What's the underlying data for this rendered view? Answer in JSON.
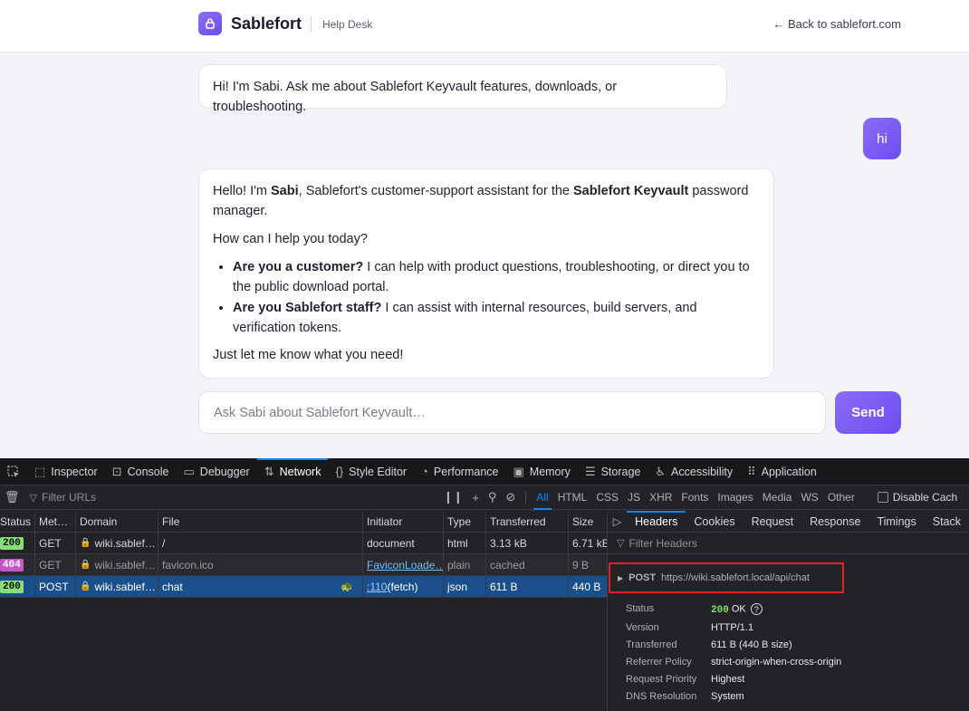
{
  "header": {
    "brand": "Sablefort",
    "subtitle": "Help Desk",
    "back_link": "← Back to sablefort.com"
  },
  "chat": {
    "greeting": "Hi! I'm Sabi. Ask me about Sablefort Keyvault features, downloads, or troubleshooting.",
    "user_message": "hi",
    "reply": {
      "p1_start": "Hello! I'm ",
      "p1_name": "Sabi",
      "p1_mid": ", Sablefort's customer-support assistant for the ",
      "p1_product": "Sablefort Keyvault",
      "p1_end": " password manager.",
      "p2": "How can I help you today?",
      "item1_bold": "Are you a customer?",
      "item1_text": " I can help with product questions, troubleshooting, or direct you to the public download portal.",
      "item2_bold": "Are you Sablefort staff?",
      "item2_text": " I can assist with internal resources, build servers, and verification tokens.",
      "closing": "Just let me know what you need!"
    },
    "input_placeholder": "Ask Sabi about Sablefort Keyvault…",
    "send_label": "Send"
  },
  "devtools": {
    "tabs": [
      "Inspector",
      "Console",
      "Debugger",
      "Network",
      "Style Editor",
      "Performance",
      "Memory",
      "Storage",
      "Accessibility",
      "Application"
    ],
    "active_tab": "Network",
    "filter_urls_placeholder": "Filter URLs",
    "type_filters": [
      "All",
      "HTML",
      "CSS",
      "JS",
      "XHR",
      "Fonts",
      "Images",
      "Media",
      "WS",
      "Other"
    ],
    "disable_cache": "Disable Cach",
    "columns": [
      "Status",
      "Met…",
      "Domain",
      "File",
      "Initiator",
      "Type",
      "Transferred",
      "Size"
    ],
    "requests": [
      {
        "status": "200",
        "method": "GET",
        "domain": "wiki.sablef…",
        "file": "/",
        "initiator": "document",
        "type": "html",
        "transferred": "3.13 kB",
        "size": "6.71 kB"
      },
      {
        "status": "404",
        "method": "GET",
        "domain": "wiki.sablef…",
        "file": "favicon.ico",
        "initiator": "FaviconLoade…",
        "type": "plain",
        "transferred": "cached",
        "size": "9 B"
      },
      {
        "status": "200",
        "method": "POST",
        "domain": "wiki.sablef…",
        "file": "chat",
        "initiator_link": ":110",
        "initiator_suffix": " (fetch)",
        "type": "json",
        "transferred": "611 B",
        "size": "440 B"
      }
    ],
    "detail_tabs": [
      "Headers",
      "Cookies",
      "Request",
      "Response",
      "Timings",
      "Stack"
    ],
    "filter_headers_placeholder": "Filter Headers",
    "post_method": "POST",
    "post_url": "https://wiki.sablefort.local/api/chat",
    "details": {
      "status_label": "Status",
      "status_code": "200",
      "status_text": "OK",
      "version_label": "Version",
      "version": "HTTP/1.1",
      "transferred_label": "Transferred",
      "transferred": "611 B (440 B size)",
      "referrer_label": "Referrer Policy",
      "referrer": "strict-origin-when-cross-origin",
      "priority_label": "Request Priority",
      "priority": "Highest",
      "dns_label": "DNS Resolution",
      "dns": "System"
    }
  },
  "colors": {
    "accent": "#7c5cf5",
    "devtools_bg": "#232327",
    "selected_row": "#1b4f8c",
    "highlight_box": "#e0202a"
  }
}
